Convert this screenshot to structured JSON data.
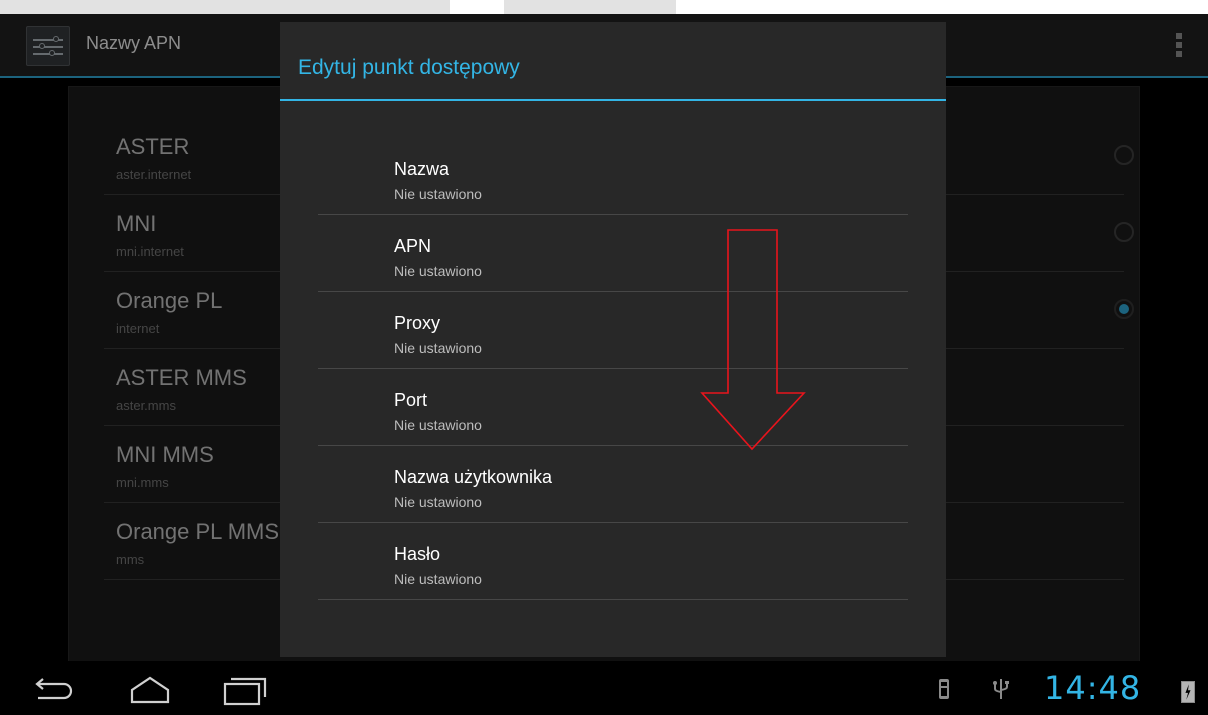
{
  "action_bar": {
    "title": "Nazwy APN",
    "app_icon": "settings-sliders-icon",
    "menu_icon": "overflow-menu-icon"
  },
  "apn_list": [
    {
      "name": "ASTER",
      "apn": "aster.internet",
      "selectable": true,
      "selected": false
    },
    {
      "name": "MNI",
      "apn": "mni.internet",
      "selectable": true,
      "selected": false
    },
    {
      "name": "Orange PL",
      "apn": "internet",
      "selectable": true,
      "selected": true
    },
    {
      "name": "ASTER MMS",
      "apn": "aster.mms",
      "selectable": false,
      "selected": false
    },
    {
      "name": "MNI MMS",
      "apn": "mni.mms",
      "selectable": false,
      "selected": false
    },
    {
      "name": "Orange PL MMS",
      "apn": "mms",
      "selectable": false,
      "selected": false
    }
  ],
  "dialog": {
    "title": "Edytuj punkt dostępowy",
    "fields": [
      {
        "label": "Nazwa",
        "value": "Nie ustawiono"
      },
      {
        "label": "APN",
        "value": "Nie ustawiono"
      },
      {
        "label": "Proxy",
        "value": "Nie ustawiono"
      },
      {
        "label": "Port",
        "value": "Nie ustawiono"
      },
      {
        "label": "Nazwa użytkownika",
        "value": "Nie ustawiono"
      },
      {
        "label": "Hasło",
        "value": "Nie ustawiono"
      }
    ]
  },
  "annotation": {
    "icon": "scroll-down-arrow",
    "color": "#e8141c"
  },
  "nav_bar": {
    "buttons": [
      "back-icon",
      "home-icon",
      "recent-apps-icon"
    ],
    "status_icons": [
      "android-debug-icon",
      "usb-icon",
      "battery-charging-icon"
    ],
    "time": "14:48"
  },
  "colors": {
    "accent": "#33b5e5",
    "dialog_bg": "#282828",
    "action_bar_bg": "#242424"
  }
}
